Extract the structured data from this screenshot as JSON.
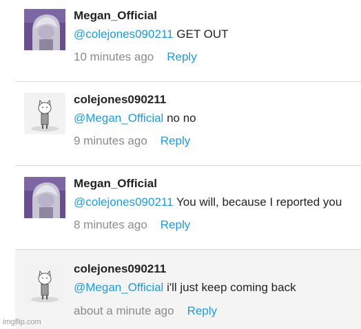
{
  "comments": [
    {
      "username": "Megan_Official",
      "mention": "@colejones090211",
      "text": " GET OUT",
      "time": "10 minutes ago",
      "reply": "Reply",
      "avatar": "purple-haired-character-avatar"
    },
    {
      "username": "colejones090211",
      "mention": "@Megan_Official",
      "text": " no no",
      "time": "9 minutes ago",
      "reply": "Reply",
      "avatar": "white-cat-figure-avatar"
    },
    {
      "username": "Megan_Official",
      "mention": "@colejones090211",
      "text": " You will, because I reported you",
      "time": "8 minutes ago",
      "reply": "Reply",
      "avatar": "purple-haired-character-avatar"
    },
    {
      "username": "colejones090211",
      "mention": "@Megan_Official",
      "text": " i'll just keep coming back",
      "time": "about a minute ago",
      "reply": "Reply",
      "avatar": "white-cat-figure-avatar"
    }
  ],
  "watermark": "imgflip.com",
  "colors": {
    "link": "#1e9bd7",
    "muted": "#8a8a8a",
    "highlight_bg": "#f4f4f4"
  }
}
